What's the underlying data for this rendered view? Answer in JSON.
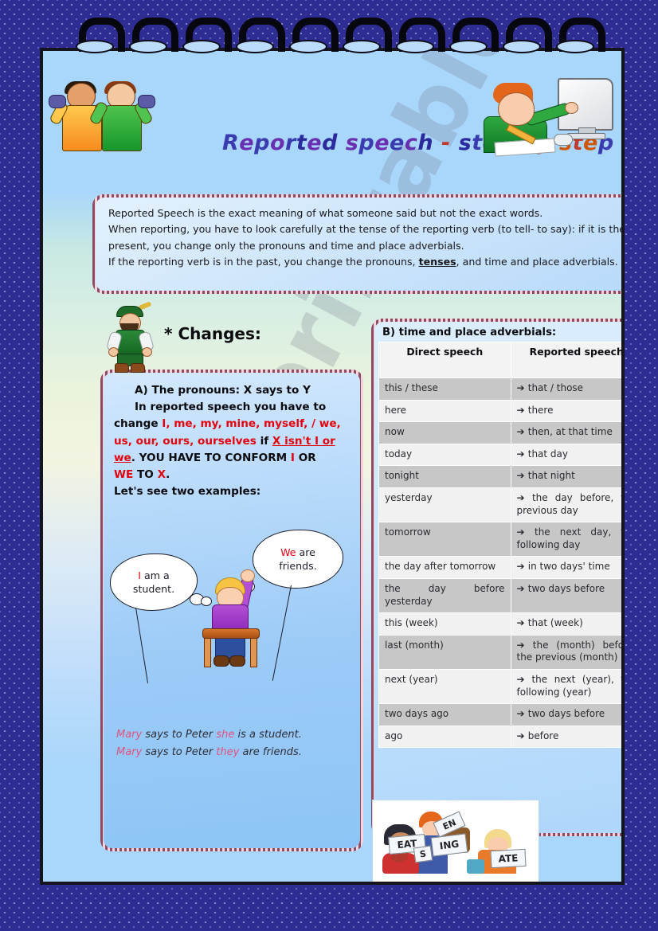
{
  "worksheet": {
    "title": "Reported speech - step by step",
    "title_letters": [
      {
        "ch": "R",
        "color": "#3b3bb0"
      },
      {
        "ch": "e",
        "color": "#6a2fb0"
      },
      {
        "ch": "p",
        "color": "#3b3bb0"
      },
      {
        "ch": "o",
        "color": "#6a2fb0"
      },
      {
        "ch": "r",
        "color": "#3b3bb0"
      },
      {
        "ch": "t",
        "color": "#2a2a9c"
      },
      {
        "ch": "e",
        "color": "#6a2fb0"
      },
      {
        "ch": "d",
        "color": "#2a2a9c"
      },
      {
        "ch": " ",
        "color": "#2a2a9c"
      },
      {
        "ch": "s",
        "color": "#6a2fb0"
      },
      {
        "ch": "p",
        "color": "#3b3bb0"
      },
      {
        "ch": "e",
        "color": "#6a2fb0"
      },
      {
        "ch": "e",
        "color": "#3b3bb0"
      },
      {
        "ch": "c",
        "color": "#6a2fb0"
      },
      {
        "ch": "h",
        "color": "#2a2a9c"
      },
      {
        "ch": " ",
        "color": "#2a2a9c"
      },
      {
        "ch": "-",
        "color": "#c0392b"
      },
      {
        "ch": " ",
        "color": "#2a2a9c"
      },
      {
        "ch": "s",
        "color": "#2a2a9c"
      },
      {
        "ch": "t",
        "color": "#3b3bb0"
      },
      {
        "ch": "e",
        "color": "#6a2fb0"
      },
      {
        "ch": "p",
        "color": "#2a2a9c"
      },
      {
        "ch": " ",
        "color": "#2a2a9c"
      },
      {
        "ch": "b",
        "color": "#8e2fb0"
      },
      {
        "ch": "y",
        "color": "#c0392b"
      },
      {
        "ch": " ",
        "color": "#2a2a9c"
      },
      {
        "ch": "s",
        "color": "#d35400"
      },
      {
        "ch": "t",
        "color": "#c0392b"
      },
      {
        "ch": "e",
        "color": "#d35400"
      },
      {
        "ch": "p",
        "color": "#3b3bb0"
      }
    ],
    "watermark": "ESLprintables.com"
  },
  "intro": {
    "line1": "Reported Speech is the exact meaning of what someone said but not the exact words.",
    "line2": "When reporting, you have to look carefully at the tense of the reporting verb (to tell- to say): if it is the present, you change only the pronouns and time and place adverbials.",
    "line3_a": "If the reporting verb is in the past, you change the pronouns, ",
    "line3_u": "tenses",
    "line3_b": ", and time and place adverbials."
  },
  "changes": {
    "marker": "*",
    "label": "Changes:"
  },
  "pronouns": {
    "heading": "A) The pronouns: X says to Y",
    "line1": "In reported speech you have to",
    "line2_pre": "change ",
    "line2_red": "I, me, my, mine, myself, / we,",
    "line3_red": "us, our, ours, ourselves",
    "line3_mid": " if ",
    "line3_u1": "X isn't I or",
    "line4_u2": "we",
    "line4_post": ". YOU HAVE TO CONFORM ",
    "line4_red1": "I",
    "line4_mid": " OR",
    "line5_red2": "WE",
    "line5_to": " TO ",
    "line5_red3": "X",
    "line5_end": ".",
    "line6": "Let's see two examples:",
    "bubble_left": {
      "red": "I",
      "rest": "am a",
      "line2": "student."
    },
    "bubble_right": {
      "red": "We",
      "rest": "are",
      "line2": "friends."
    },
    "example1": {
      "pink1": "Mary",
      "mid1": " says to Peter ",
      "pink2": "she",
      "mid2": " is a   student."
    },
    "example2": {
      "pink1": "Mary",
      "mid1": " says to Peter ",
      "pink2": "they",
      "mid2": " are friends."
    }
  },
  "adverbials": {
    "title": "B) time and place adverbials:",
    "columns": [
      "Direct speech",
      "Reported speech"
    ],
    "arrow": "➔",
    "rows": [
      {
        "direct": "this / these",
        "reported": "that / those"
      },
      {
        "direct": "here",
        "reported": "there"
      },
      {
        "direct": "now",
        "reported": "then, at that time"
      },
      {
        "direct": "today",
        "reported": "that day"
      },
      {
        "direct": "tonight",
        "reported": "that night"
      },
      {
        "direct": "yesterday",
        "reported": "the day before, the previous day"
      },
      {
        "direct": "tomorrow",
        "reported": "the next day, the following day"
      },
      {
        "direct": "the day after tomorrow",
        "reported": "in two days' time"
      },
      {
        "direct": "the day before yesterday",
        "reported": "two days before"
      },
      {
        "direct": "this (week)",
        "reported": "that (week)"
      },
      {
        "direct": "last (month)",
        "reported": "the (month) before, the previous (month)"
      },
      {
        "direct": "next (year)",
        "reported": "the next (year), the following (year)"
      },
      {
        "direct": "two days ago",
        "reported": "two days before"
      },
      {
        "direct": "ago",
        "reported": "before"
      }
    ]
  },
  "bottom_picture": {
    "signs": [
      "EAT",
      "S",
      "ING",
      "EN",
      "ATE"
    ]
  },
  "colors": {
    "page_border": "#15151f",
    "backdrop": "#2d2d93",
    "accent_red": "#e3000f",
    "accent_pink": "#e0527d",
    "frame_pink": "#8e4a63",
    "row_dark": "#c7c7c7",
    "row_light": "#f1f1f1"
  }
}
